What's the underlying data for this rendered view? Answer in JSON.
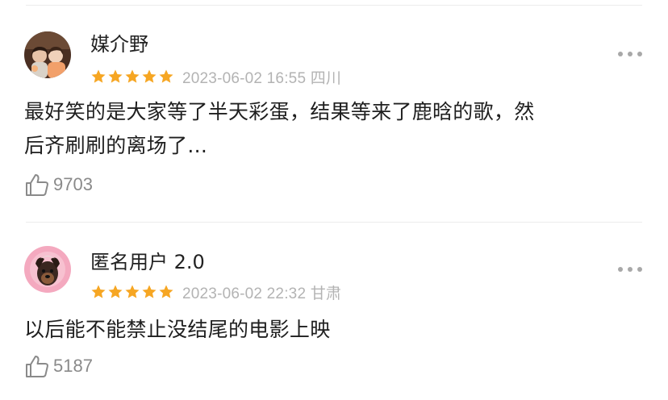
{
  "comments": [
    {
      "avatar_icon": "photo-avatar-two-children",
      "username": "媒介野",
      "rating": 5,
      "date_location": "2023-06-02 16:55 四川",
      "content_lines": [
        "最好笑的是大家等了半天彩蛋，结果等来了鹿晗的歌，然",
        "后齐刷刷的离场了..."
      ],
      "likes": "9703"
    },
    {
      "avatar_icon": "photo-avatar-dog",
      "username": "匿名用户 2.0",
      "rating": 5,
      "date_location": "2023-06-02 22:32 甘肃",
      "content_lines": [
        "以后能不能禁止没结尾的电影上映"
      ],
      "likes": "5187"
    }
  ],
  "colors": {
    "star": "#f6a623",
    "meta_text": "#b3b3b3",
    "likes_text": "#8a8a8a",
    "divider": "#ececec"
  }
}
